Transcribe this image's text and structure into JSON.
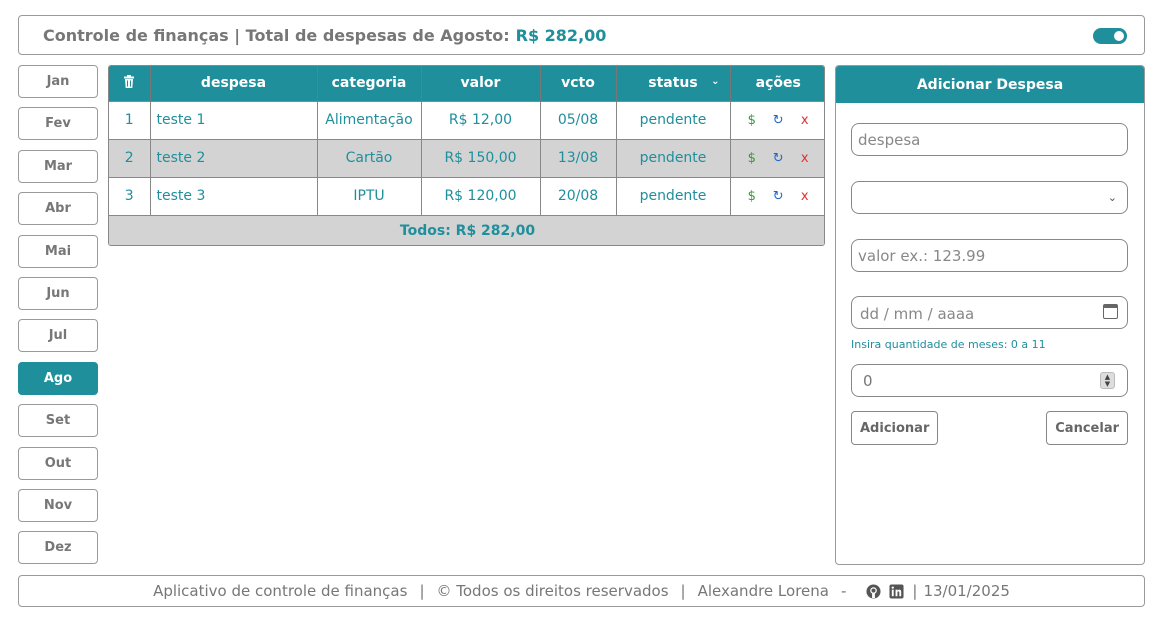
{
  "header": {
    "title": "Controle de finanças | Total de despesas de Agosto:",
    "total": "R$ 282,00",
    "toggle_on": true
  },
  "months": {
    "items": [
      "Jan",
      "Fev",
      "Mar",
      "Abr",
      "Mai",
      "Jun",
      "Jul",
      "Ago",
      "Set",
      "Out",
      "Nov",
      "Dez"
    ],
    "active": "Ago"
  },
  "table": {
    "columns": {
      "delete_all_icon": "trash-icon",
      "despesa": "despesa",
      "categoria": "categoria",
      "valor": "valor",
      "vcto": "vcto",
      "status": "status",
      "acoes": "ações"
    },
    "rows": [
      {
        "num": "1",
        "despesa": "teste 1",
        "categoria": "Alimentação",
        "valor": "R$ 12,00",
        "vcto": "05/08",
        "status": "pendente"
      },
      {
        "num": "2",
        "despesa": "teste 2",
        "categoria": "Cartão",
        "valor": "R$ 150,00",
        "vcto": "13/08",
        "status": "pendente"
      },
      {
        "num": "3",
        "despesa": "teste 3",
        "categoria": "IPTU",
        "valor": "R$ 120,00",
        "vcto": "20/08",
        "status": "pendente"
      }
    ],
    "actions": {
      "pay": "$",
      "edit": "↻",
      "delete": "x"
    },
    "total_label": "Todos: R$ 282,00"
  },
  "form": {
    "title": "Adicionar Despesa",
    "despesa_placeholder": "despesa",
    "categoria_value": "",
    "valor_placeholder": "valor ex.: 123.99",
    "date_placeholder": "dd / mm / aaaa",
    "hint": "Insira quantidade de meses: 0 a 11",
    "meses_value": "0",
    "add_label": "Adicionar",
    "cancel_label": "Cancelar"
  },
  "footer": {
    "app": "Aplicativo de controle de finanças",
    "sep1": "|",
    "rights": "© Todos os direitos reservados",
    "sep2": "|",
    "author": "Alexandre Lorena",
    "dash": "-",
    "sep3": "|",
    "date": "13/01/2025"
  },
  "colors": {
    "accent": "#1f8f9c",
    "row_alt": "#d3d3d3"
  }
}
